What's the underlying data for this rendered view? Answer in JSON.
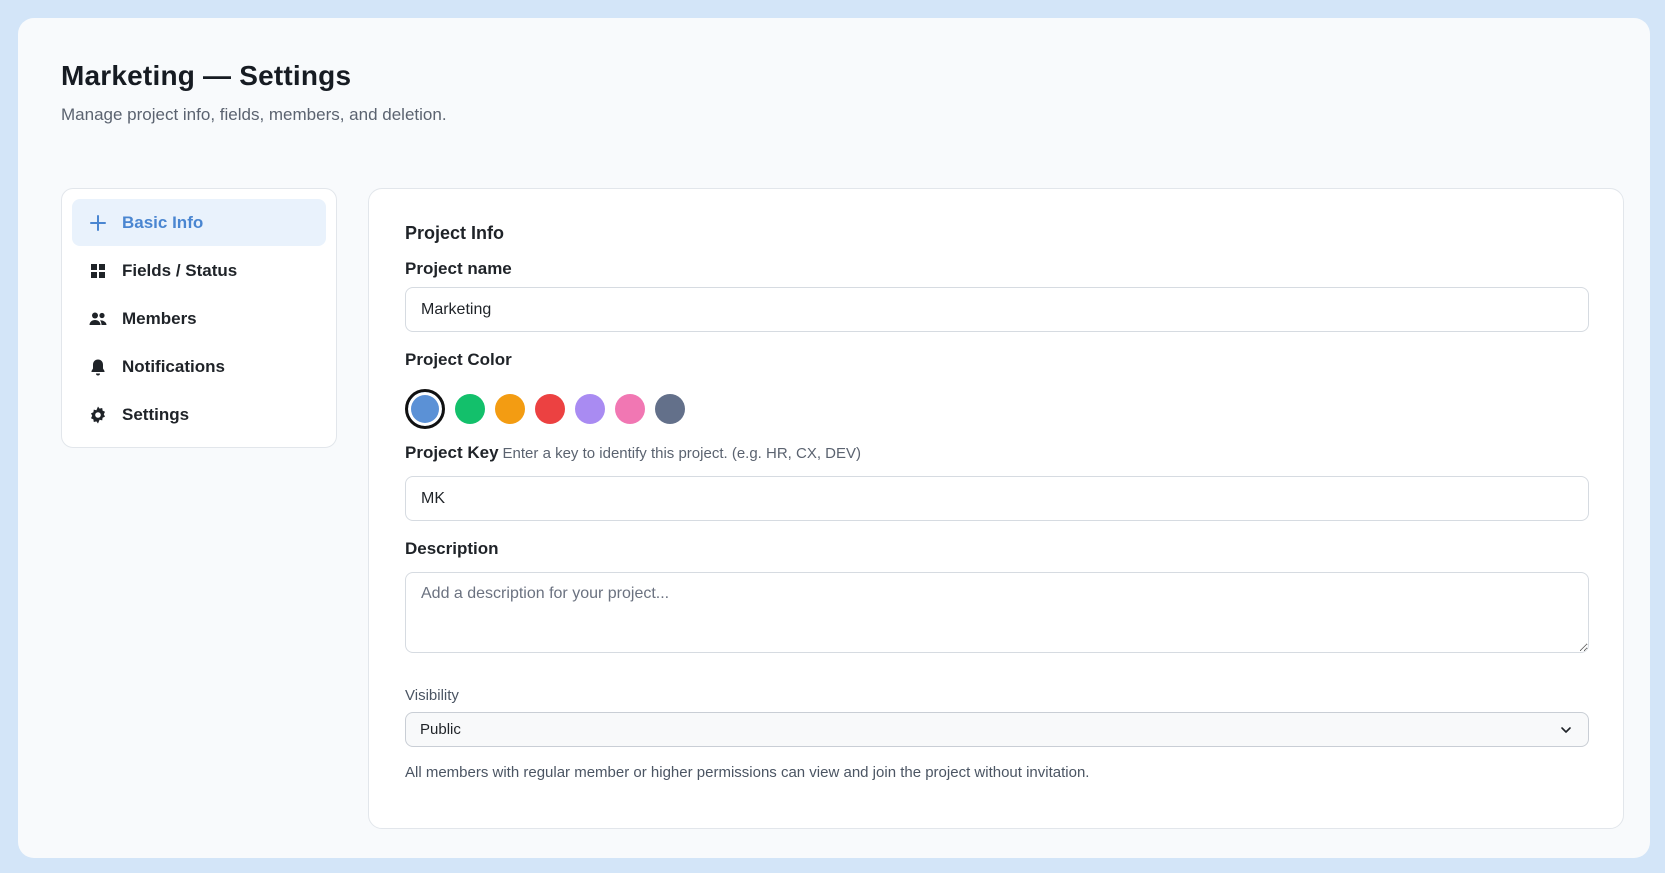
{
  "header": {
    "title": "Marketing — Settings",
    "subtitle": "Manage project info, fields, members, and deletion."
  },
  "sidebar": {
    "items": [
      {
        "label": "Basic Info",
        "icon": "plus-icon",
        "active": true
      },
      {
        "label": "Fields / Status",
        "icon": "grid-icon",
        "active": false
      },
      {
        "label": "Members",
        "icon": "users-icon",
        "active": false
      },
      {
        "label": "Notifications",
        "icon": "bell-icon",
        "active": false
      },
      {
        "label": "Settings",
        "icon": "gear-icon",
        "active": false
      }
    ]
  },
  "form": {
    "section_title": "Project Info",
    "project_name": {
      "label": "Project name",
      "value": "Marketing"
    },
    "project_color": {
      "label": "Project Color",
      "colors": [
        "#5b91d6",
        "#13c06b",
        "#f39c12",
        "#ec4141",
        "#a98bf2",
        "#f177b3",
        "#63708a"
      ],
      "selected_index": 0
    },
    "project_key": {
      "label": "Project Key",
      "hint": "Enter a key to identify this project. (e.g. HR, CX, DEV)",
      "value": "MK"
    },
    "description": {
      "label": "Description",
      "placeholder": "Add a description for your project...",
      "value": ""
    },
    "visibility": {
      "label": "Visibility",
      "value": "Public",
      "help": "All members with regular member or higher permissions can view and join the project without invitation."
    }
  },
  "colors": {
    "accent": "#4a86d1",
    "active_bg": "#e9f2fc",
    "outer_bg": "#d3e5f8"
  }
}
